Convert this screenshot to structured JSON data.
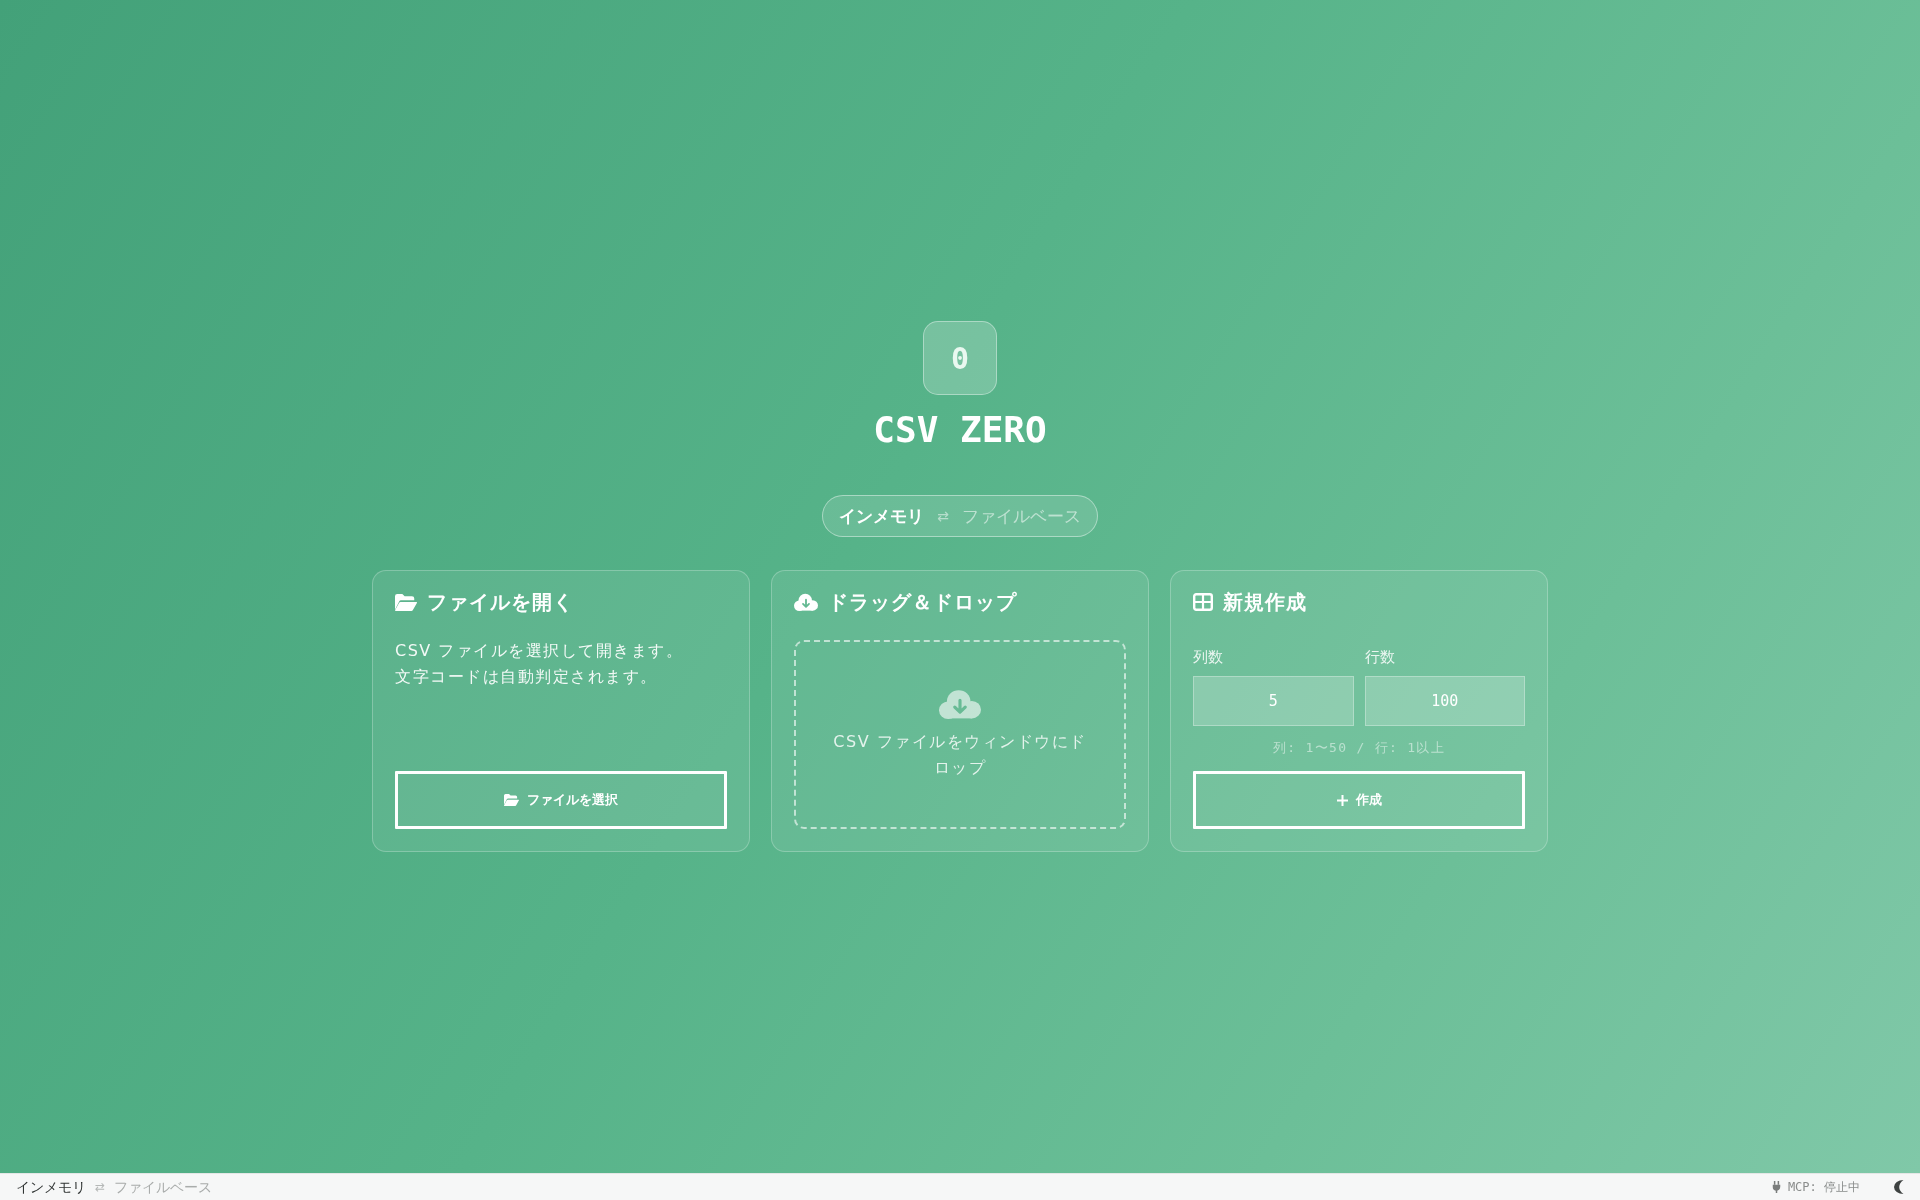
{
  "app": {
    "logo": "0",
    "title": "CSV ZERO"
  },
  "mode_toggle": {
    "options": [
      {
        "label": "インメモリ",
        "selected": true
      },
      {
        "label": "ファイルベース",
        "selected": false
      }
    ],
    "separator": "⇄"
  },
  "cards": [
    {
      "kind": "open",
      "title": "ファイルを開く",
      "description_lines": [
        "CSV ファイルを選択して開きます。",
        "文字コードは自動判定されます。"
      ],
      "button": "ファイルを選択"
    },
    {
      "kind": "drop",
      "title": "ドラッグ＆ドロップ",
      "drop_text": "CSV ファイルをウィンドウにドロップ"
    },
    {
      "kind": "create",
      "title": "新規作成",
      "fields": [
        {
          "label": "列数",
          "value": "5"
        },
        {
          "label": "行数",
          "value": "100"
        }
      ],
      "hint": "列: 1〜50 / 行: 1以上",
      "button": "作成"
    }
  ],
  "status_bar": {
    "mode_toggle": {
      "options": [
        {
          "label": "インメモリ",
          "selected": true
        },
        {
          "label": "ファイルベース",
          "selected": false
        }
      ],
      "separator": "⇄"
    },
    "mcp_status": "MCP: 停止中"
  }
}
